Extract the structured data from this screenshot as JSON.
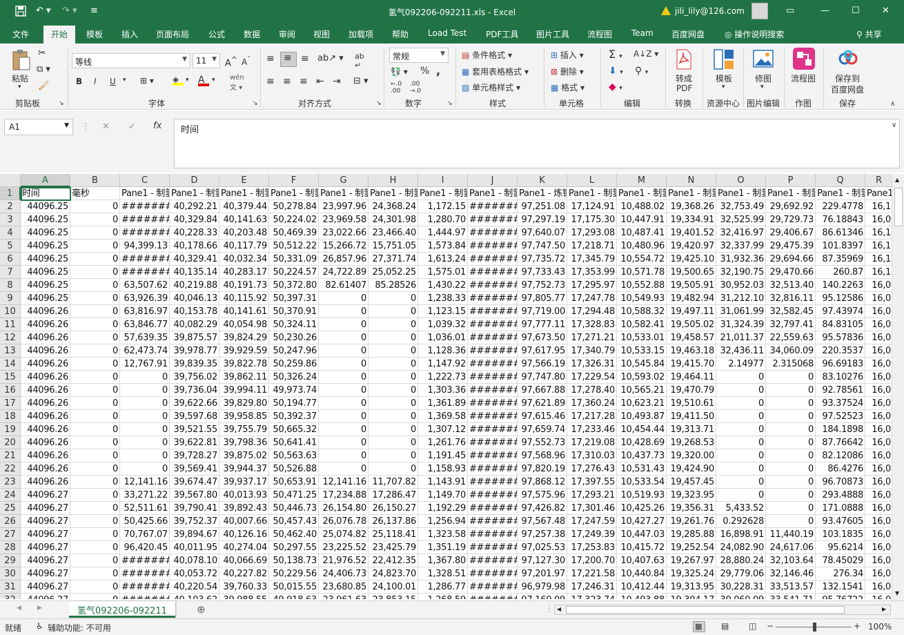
{
  "window": {
    "title": "氢气092206-092211.xls  -  Excel",
    "account": "jili_lily@126.com",
    "minimize": "—",
    "restore": "☐",
    "close": "✕",
    "ribbon_display": "▭"
  },
  "tabs": [
    "文件",
    "开始",
    "模板",
    "插入",
    "页面布局",
    "公式",
    "数据",
    "审阅",
    "视图",
    "加载项",
    "帮助",
    "Load Test",
    "PDF工具",
    "图片工具",
    "流程图",
    "Team",
    "百度网盘",
    "操作说明搜索",
    "共享"
  ],
  "ribbon": {
    "groups": [
      "剪贴板",
      "字体",
      "对齐方式",
      "数字",
      "样式",
      "单元格",
      "编辑",
      "转换",
      "资源中心",
      "图片编辑",
      "作图",
      "保存"
    ],
    "paste": "粘贴",
    "font_name": "等线",
    "font_size": "11",
    "number_format": "常规",
    "conditional_format": "条件格式",
    "table_format": "套用表格格式",
    "cell_style": "单元格样式",
    "insert": "插入",
    "delete": "删除",
    "format": "格式",
    "to_pdf_1": "转成",
    "to_pdf_2": "PDF",
    "template": "模板",
    "picture_edit": "修图",
    "flowchart": "流程图",
    "save_to_1": "保存到",
    "save_to_2": "百度网盘",
    "bold": "B",
    "italic": "I",
    "underline": "U",
    "percent": "%",
    "comma": ","
  },
  "formula": {
    "name_box": "A1",
    "value": "时间",
    "fx": "fx",
    "cancel": "✕",
    "enter": "✓"
  },
  "columns": [
    "A",
    "B",
    "C",
    "D",
    "E",
    "F",
    "G",
    "H",
    "I",
    "J",
    "K",
    "L",
    "M",
    "N",
    "O",
    "P",
    "Q",
    "R"
  ],
  "headers": [
    "时间",
    "毫秒",
    "Pane1 - 制氢",
    "Pane1 - 制氢",
    "Pane1 - 制氢",
    "Pane1 - 制氢",
    "Pane1 - 制氢",
    "Pane1 - 制氢",
    "Pane1 - 制氢",
    "Pane1 - 制氢",
    "Pane1 - 炼钢",
    "Pane1 - 制氢",
    "Pane1 - 制氢",
    "Pane1 - 制氢",
    "Pane1 - 制氢",
    "Pane1 - 制氢",
    "Pane1 - 制氢",
    "Pane1"
  ],
  "rows": [
    [
      "44096.25",
      "0",
      "#######",
      "40,292.21",
      "40,379.44",
      "50,278.84",
      "23,997.96",
      "24,368.24",
      "1,172.15",
      "#######",
      "97,251.08",
      "17,124.91",
      "10,488.02",
      "19,368.26",
      "32,753.49",
      "29,692.92",
      "229.4778",
      "16,1"
    ],
    [
      "44096.25",
      "0",
      "#######",
      "40,329.84",
      "40,141.63",
      "50,224.02",
      "23,969.58",
      "24,301.98",
      "1,280.70",
      "#######",
      "97,297.19",
      "17,175.30",
      "10,447.91",
      "19,334.91",
      "32,525.99",
      "29,729.73",
      "76.18843",
      "16,0"
    ],
    [
      "44096.25",
      "0",
      "#######",
      "40,228.33",
      "40,203.48",
      "50,469.39",
      "23,022.66",
      "23,466.40",
      "1,444.97",
      "#######",
      "97,640.07",
      "17,293.08",
      "10,487.41",
      "19,401.52",
      "32,416.97",
      "29,406.67",
      "86.61346",
      "16,1"
    ],
    [
      "44096.25",
      "0",
      "94,399.13",
      "40,178.66",
      "40,117.79",
      "50,512.22",
      "15,266.72",
      "15,751.05",
      "1,573.84",
      "#######",
      "97,747.50",
      "17,218.71",
      "10,480.96",
      "19,420.97",
      "32,337.99",
      "29,475.39",
      "101.8397",
      "16,1"
    ],
    [
      "44096.25",
      "0",
      "#######",
      "40,329.41",
      "40,032.34",
      "50,331.09",
      "26,857.96",
      "27,371.74",
      "1,613.24",
      "#######",
      "97,735.72",
      "17,345.79",
      "10,554.72",
      "19,425.10",
      "31,932.36",
      "29,694.66",
      "87.35969",
      "16,1"
    ],
    [
      "44096.25",
      "0",
      "#######",
      "40,135.14",
      "40,283.17",
      "50,224.57",
      "24,722.89",
      "25,052.25",
      "1,575.01",
      "#######",
      "97,733.43",
      "17,353.99",
      "10,571.78",
      "19,500.65",
      "32,190.75",
      "29,470.66",
      "260.87",
      "16,1"
    ],
    [
      "44096.25",
      "0",
      "63,507.62",
      "40,219.88",
      "40,191.73",
      "50,372.80",
      "82.61407",
      "85.28526",
      "1,430.22",
      "#######",
      "97,752.73",
      "17,295.97",
      "10,552.88",
      "19,505.91",
      "30,952.03",
      "32,513.40",
      "140.2263",
      "16,0"
    ],
    [
      "44096.25",
      "0",
      "63,926.39",
      "40,046.13",
      "40,115.92",
      "50,397.31",
      "0",
      "0",
      "1,238.33",
      "#######",
      "97,805.77",
      "17,247.78",
      "10,549.93",
      "19,482.94",
      "31,212.10",
      "32,816.11",
      "95.12586",
      "16,0"
    ],
    [
      "44096.26",
      "0",
      "63,816.97",
      "40,153.78",
      "40,141.61",
      "50,370.91",
      "0",
      "0",
      "1,123.15",
      "#######",
      "97,719.00",
      "17,294.48",
      "10,588.32",
      "19,497.11",
      "31,061.99",
      "32,582.45",
      "97.43974",
      "16,0"
    ],
    [
      "44096.26",
      "0",
      "63,846.77",
      "40,082.29",
      "40,054.98",
      "50,324.11",
      "0",
      "0",
      "1,039.32",
      "#######",
      "97,777.11",
      "17,328.83",
      "10,582.41",
      "19,505.02",
      "31,324.39",
      "32,797.41",
      "84.83105",
      "16,0"
    ],
    [
      "44096.26",
      "0",
      "57,639.35",
      "39,875.57",
      "39,824.29",
      "50,230.26",
      "0",
      "0",
      "1,036.01",
      "#######",
      "97,673.50",
      "17,271.21",
      "10,533.01",
      "19,458.57",
      "21,011.37",
      "22,559.63",
      "95.57836",
      "16,0"
    ],
    [
      "44096.26",
      "0",
      "62,473.74",
      "39,978.77",
      "39,929.59",
      "50,247.96",
      "0",
      "0",
      "1,128.36",
      "#######",
      "97,617.95",
      "17,340.79",
      "10,533.15",
      "19,463.18",
      "32,436.11",
      "34,060.09",
      "220.3537",
      "16,0"
    ],
    [
      "44096.26",
      "0",
      "12,767.91",
      "39,839.35",
      "39,822.78",
      "50,259.86",
      "0",
      "0",
      "1,147.92",
      "#######",
      "97,566.19",
      "17,326.31",
      "10,545.84",
      "19,415.70",
      "2.14977",
      "2.315068",
      "96.69183",
      "16,0"
    ],
    [
      "44096.26",
      "0",
      "0",
      "39,756.02",
      "39,862.11",
      "50,326.24",
      "0",
      "0",
      "1,222.73",
      "#######",
      "97,747.80",
      "17,229.54",
      "10,593.02",
      "19,464.11",
      "0",
      "0",
      "83.10276",
      "16,0"
    ],
    [
      "44096.26",
      "0",
      "0",
      "39,736.04",
      "39,994.11",
      "49,973.74",
      "0",
      "0",
      "1,303.36",
      "#######",
      "97,667.88",
      "17,278.40",
      "10,565.21",
      "19,470.79",
      "0",
      "0",
      "92.78561",
      "16,0"
    ],
    [
      "44096.26",
      "0",
      "0",
      "39,622.66",
      "39,829.80",
      "50,194.77",
      "0",
      "0",
      "1,361.89",
      "#######",
      "97,621.89",
      "17,360.24",
      "10,623.21",
      "19,510.61",
      "0",
      "0",
      "93.37524",
      "16,0"
    ],
    [
      "44096.26",
      "0",
      "0",
      "39,597.68",
      "39,958.85",
      "50,392.37",
      "0",
      "0",
      "1,369.58",
      "#######",
      "97,615.46",
      "17,217.28",
      "10,493.87",
      "19,411.50",
      "0",
      "0",
      "97.52523",
      "16,0"
    ],
    [
      "44096.26",
      "0",
      "0",
      "39,521.55",
      "39,755.79",
      "50,665.32",
      "0",
      "0",
      "1,307.12",
      "#######",
      "97,659.74",
      "17,233.46",
      "10,454.44",
      "19,313.71",
      "0",
      "0",
      "184.1898",
      "16,0"
    ],
    [
      "44096.26",
      "0",
      "0",
      "39,622.81",
      "39,798.36",
      "50,641.41",
      "0",
      "0",
      "1,261.76",
      "#######",
      "97,552.73",
      "17,219.08",
      "10,428.69",
      "19,268.53",
      "0",
      "0",
      "87.76642",
      "16,0"
    ],
    [
      "44096.26",
      "0",
      "0",
      "39,728.27",
      "39,875.02",
      "50,563.63",
      "0",
      "0",
      "1,191.45",
      "#######",
      "97,568.96",
      "17,310.03",
      "10,437.73",
      "19,320.00",
      "0",
      "0",
      "82.12086",
      "16,0"
    ],
    [
      "44096.26",
      "0",
      "0",
      "39,569.41",
      "39,944.37",
      "50,526.88",
      "0",
      "0",
      "1,158.93",
      "#######",
      "97,820.19",
      "17,276.43",
      "10,531.43",
      "19,424.90",
      "0",
      "0",
      "86.4276",
      "16,0"
    ],
    [
      "44096.26",
      "0",
      "12,141.16",
      "39,674.47",
      "39,937.17",
      "50,653.91",
      "12,141.16",
      "11,707.82",
      "1,143.91",
      "#######",
      "97,868.12",
      "17,397.55",
      "10,533.54",
      "19,457.45",
      "0",
      "0",
      "96.70873",
      "16,0"
    ],
    [
      "44096.27",
      "0",
      "33,271.22",
      "39,567.80",
      "40,013.93",
      "50,471.25",
      "17,234.88",
      "17,286.47",
      "1,149.70",
      "#######",
      "97,575.96",
      "17,293.21",
      "10,519.93",
      "19,323.95",
      "0",
      "0",
      "293.4888",
      "16,0"
    ],
    [
      "44096.27",
      "0",
      "52,511.61",
      "39,790.41",
      "39,892.43",
      "50,446.73",
      "26,154.80",
      "26,150.27",
      "1,192.29",
      "#######",
      "97,426.82",
      "17,301.46",
      "10,425.26",
      "19,356.31",
      "5,433.52",
      "0",
      "171.0888",
      "16,0"
    ],
    [
      "44096.27",
      "0",
      "50,425.66",
      "39,752.37",
      "40,007.66",
      "50,457.43",
      "26,076.78",
      "26,137.86",
      "1,256.94",
      "#######",
      "97,567.48",
      "17,247.59",
      "10,427.27",
      "19,261.76",
      "0.292628",
      "0",
      "93.47605",
      "16,0"
    ],
    [
      "44096.27",
      "0",
      "70,767.07",
      "39,894.67",
      "40,126.16",
      "50,462.40",
      "25,074.82",
      "25,118.41",
      "1,323.58",
      "#######",
      "97,257.38",
      "17,249.39",
      "10,447.03",
      "19,285.88",
      "16,898.91",
      "11,440.19",
      "103.1835",
      "16,0"
    ],
    [
      "44096.27",
      "0",
      "96,420.45",
      "40,011.95",
      "40,274.04",
      "50,297.55",
      "23,225.52",
      "23,425.79",
      "1,351.19",
      "#######",
      "97,025.53",
      "17,253.83",
      "10,415.72",
      "19,252.54",
      "24,082.90",
      "24,617.06",
      "95.6214",
      "16,0"
    ],
    [
      "44096.27",
      "0",
      "#######",
      "40,078.10",
      "40,066.69",
      "50,138.73",
      "21,976.52",
      "22,412.35",
      "1,367.80",
      "#######",
      "97,127.30",
      "17,200.70",
      "10,407.63",
      "19,267.97",
      "28,880.24",
      "32,103.64",
      "78.45029",
      "16,0"
    ],
    [
      "44096.27",
      "0",
      "#######",
      "40,053.72",
      "40,227.82",
      "50,229.56",
      "24,406.73",
      "24,823.70",
      "1,328.51",
      "#######",
      "97,201.97",
      "17,221.58",
      "10,440.84",
      "19,325.24",
      "29,779.06",
      "32,146.46",
      "276.34",
      "16,0"
    ],
    [
      "44096.27",
      "0",
      "#######",
      "40,220.54",
      "39,760.33",
      "50,015.55",
      "23,680.85",
      "24,100.01",
      "1,286.77",
      "#######",
      "96,979.98",
      "17,246.31",
      "10,412.44",
      "19,313.95",
      "30,228.31",
      "33,513.57",
      "132.1541",
      "16,0"
    ],
    [
      "44096.27",
      "0",
      "#######",
      "40,103.62",
      "39,988.55",
      "49,918.63",
      "23,961.63",
      "23,853.15",
      "1,268.59",
      "#######",
      "97,160.09",
      "17,323.74",
      "10,403.88",
      "19,304.17",
      "30,060.09",
      "33,541.71",
      "95.76722",
      "16,0"
    ]
  ],
  "sheet": {
    "tab_name": "氢气092206-092211",
    "add": "⊕"
  },
  "status": {
    "ready": "就绪",
    "accessibility": "辅助功能: 不可用",
    "zoom": "100%",
    "zoom_minus": "−",
    "zoom_plus": "+"
  }
}
